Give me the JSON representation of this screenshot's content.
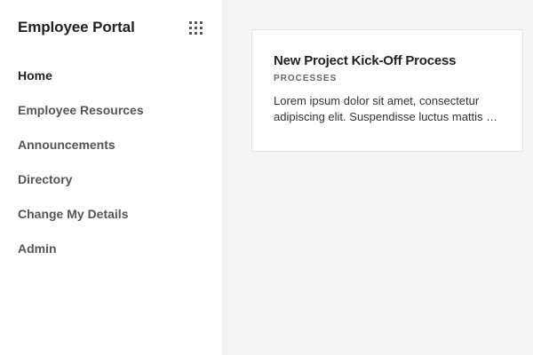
{
  "sidebar": {
    "title": "Employee Portal",
    "apps_icon": "apps-grid-icon",
    "items": [
      {
        "label": "Home",
        "active": true
      },
      {
        "label": "Employee Resources",
        "active": false
      },
      {
        "label": "Announcements",
        "active": false
      },
      {
        "label": "Directory",
        "active": false
      },
      {
        "label": "Change My Details",
        "active": false
      },
      {
        "label": "Admin",
        "active": false
      }
    ]
  },
  "main": {
    "cards": [
      {
        "title": "New Project Kick-Off Process",
        "tag": "PROCESSES",
        "description": "Lorem ipsum dolor sit amet, consectetur adipiscing elit. Suspendisse luctus mattis …"
      }
    ]
  },
  "colors": {
    "sidebar_bg": "#ffffff",
    "main_bg": "#f4f4f4",
    "text_primary": "#222222",
    "text_secondary": "#555555"
  }
}
